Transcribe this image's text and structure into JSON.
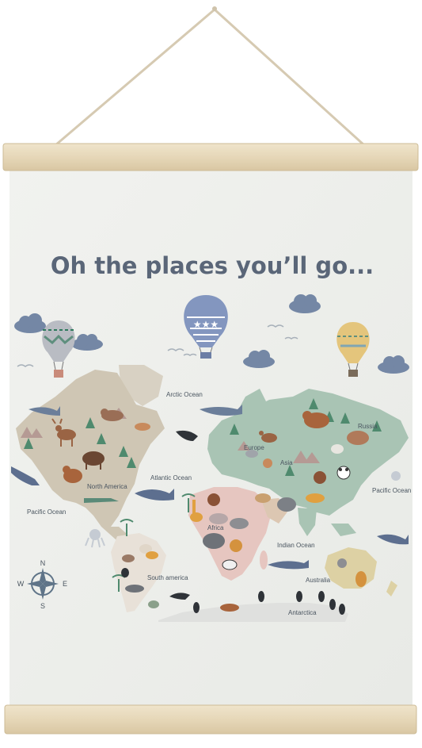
{
  "title": "Oh the places you’ll go...",
  "labels": {
    "arctic_ocean": "Arctic Ocean",
    "north_america": "North America",
    "atlantic_ocean": "Atlantic Ocean",
    "pacific_ocean_left": "Pacific Ocean",
    "pacific_ocean_right": "Pacific Ocean",
    "europe": "Europe",
    "asia": "Asia",
    "russia": "Russia",
    "africa": "Africa",
    "indian_ocean": "Indian Ocean",
    "south_america": "South america",
    "australia": "Australia",
    "antarctica": "Antarctica"
  },
  "compass": {
    "n": "N",
    "s": "S",
    "e": "E",
    "w": "W"
  },
  "colors": {
    "canvas": "#eceeea",
    "wood": "#e9dcc0",
    "rope": "#d8ccb4",
    "title": "#5a6678",
    "cloud": "#7487a5",
    "land_north_america": "#cfc6b4",
    "land_europe_asia": "#a9c4b4",
    "land_africa": "#e6c6c0",
    "land_australia": "#ddd1a4",
    "balloon_blue": "#7d8fb8",
    "balloon_yellow": "#e3c57a"
  }
}
